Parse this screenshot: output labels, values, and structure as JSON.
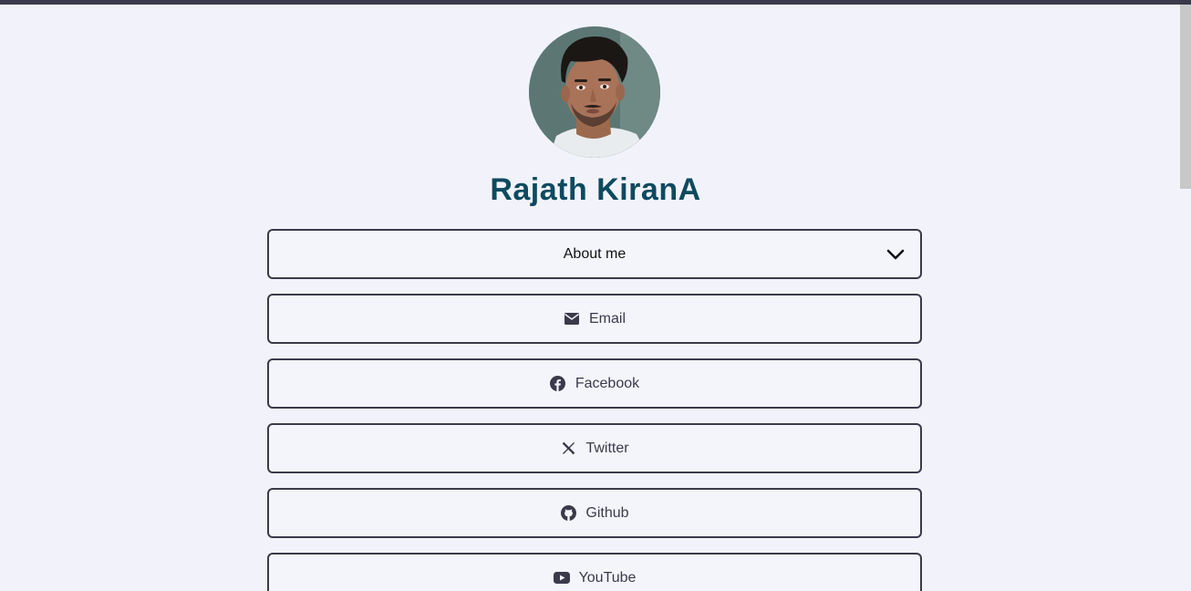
{
  "profile": {
    "name": "Rajath KiranA"
  },
  "about": {
    "label": "About me",
    "expand_icon": "chevron-down-icon"
  },
  "links": [
    {
      "label": "Email",
      "icon": "envelope-icon"
    },
    {
      "label": "Facebook",
      "icon": "facebook-icon"
    },
    {
      "label": "Twitter",
      "icon": "x-twitter-icon"
    },
    {
      "label": "Github",
      "icon": "github-icon"
    },
    {
      "label": "YouTube",
      "icon": "youtube-icon"
    }
  ],
  "colors": {
    "background": "#f2f3fa",
    "border": "#3b3a4b",
    "name": "#0e4a60",
    "top_bar": "#3b3a4b"
  }
}
